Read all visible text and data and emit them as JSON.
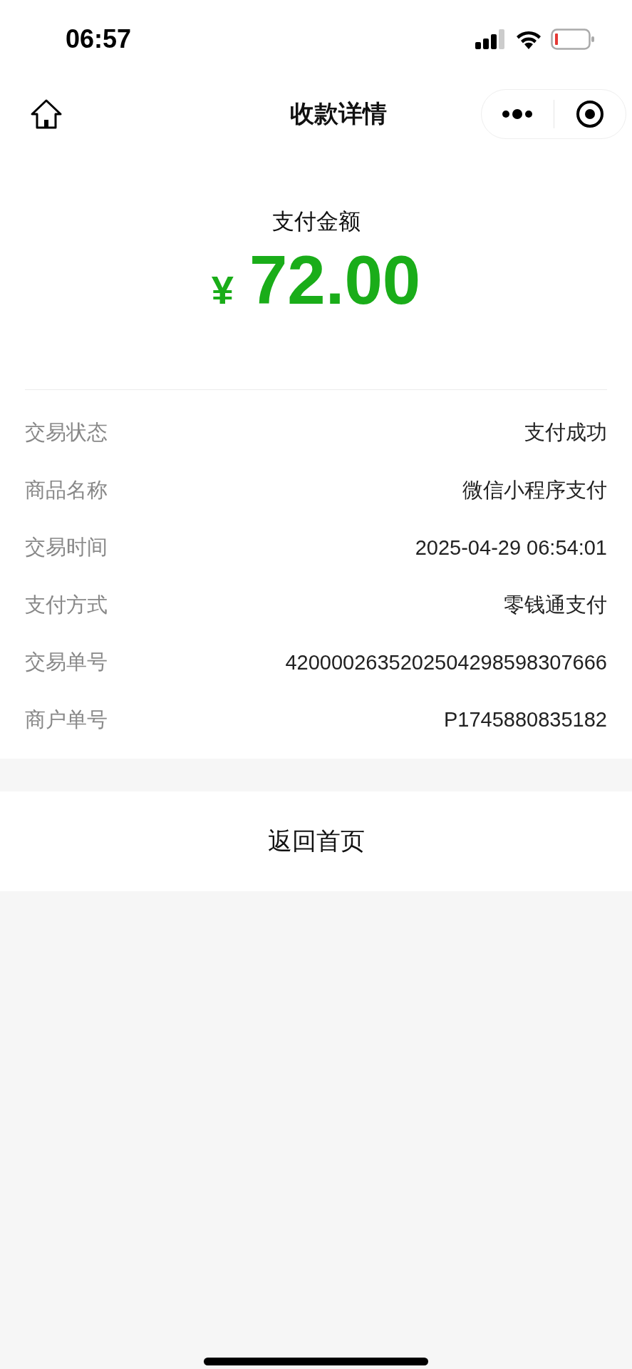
{
  "status_bar": {
    "time": "06:57"
  },
  "nav_bar": {
    "title": "收款详情"
  },
  "amount": {
    "label": "支付金额",
    "currency": "¥",
    "value": "72.00"
  },
  "details": [
    {
      "label": "交易状态",
      "value": "支付成功"
    },
    {
      "label": "商品名称",
      "value": "微信小程序支付"
    },
    {
      "label": "交易时间",
      "value": "2025-04-29 06:54:01"
    },
    {
      "label": "支付方式",
      "value": "零钱通支付"
    },
    {
      "label": "交易单号",
      "value": "4200002635202504298598307666"
    },
    {
      "label": "商户单号",
      "value": "P1745880835182"
    }
  ],
  "back_button": {
    "label": "返回首页"
  }
}
